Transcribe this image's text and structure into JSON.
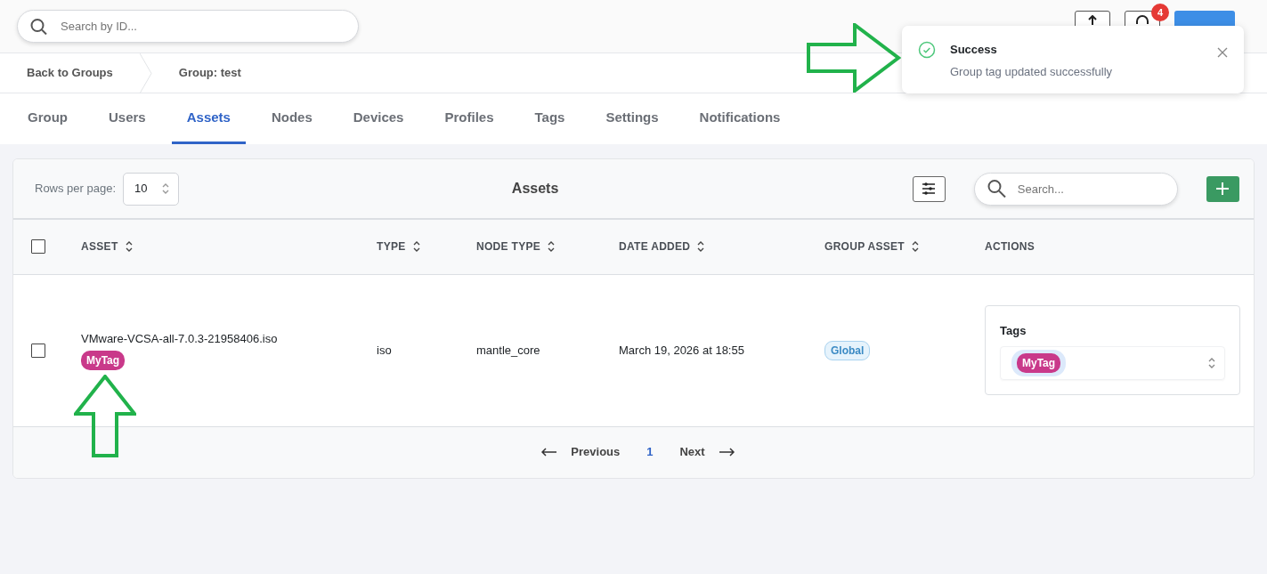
{
  "search": {
    "placeholder": "Search by ID..."
  },
  "toolbar": {
    "notification_count": "4"
  },
  "toast": {
    "title": "Success",
    "message": "Group tag updated successfully"
  },
  "breadcrumb": [
    {
      "label": "Back to Groups"
    },
    {
      "label": "Group: test"
    }
  ],
  "tabs": [
    {
      "label": "Group",
      "selected": false
    },
    {
      "label": "Users",
      "selected": false
    },
    {
      "label": "Assets",
      "selected": true
    },
    {
      "label": "Nodes",
      "selected": false
    },
    {
      "label": "Devices",
      "selected": false
    },
    {
      "label": "Profiles",
      "selected": false
    },
    {
      "label": "Tags",
      "selected": false
    },
    {
      "label": "Settings",
      "selected": false
    },
    {
      "label": "Notifications",
      "selected": false
    }
  ],
  "card": {
    "rows_per_page_label": "Rows per page:",
    "rows_per_page": "10",
    "title": "Assets",
    "search_placeholder": "Search...",
    "select_all_checked": false,
    "columns": [
      {
        "label": "ASSET",
        "sortable": true
      },
      {
        "label": "TYPE",
        "sortable": true
      },
      {
        "label": "NODE TYPE",
        "sortable": true
      },
      {
        "label": "DATE ADDED",
        "sortable": true
      },
      {
        "label": "GROUP ASSET",
        "sortable": true
      },
      {
        "label": "ACTIONS",
        "sortable": false
      }
    ],
    "rows": [
      {
        "checked": false,
        "asset": "VMware-VCSA-all-7.0.3-21958406.iso",
        "tags": [
          {
            "label": "MyTag"
          }
        ],
        "type": "iso",
        "node_type": "mantle_core",
        "date_added": "March 19, 2026 at 18:55",
        "group_asset": "Global",
        "actions_label": "Tags",
        "selected_tags": [
          {
            "label": "MyTag"
          }
        ]
      }
    ],
    "pagination": {
      "previous": "Previous",
      "pages": [
        {
          "label": "1",
          "selected": true
        }
      ],
      "next": "Next"
    }
  },
  "annotations": [
    {
      "kind": "arrow-right"
    },
    {
      "kind": "arrow-up"
    }
  ]
}
